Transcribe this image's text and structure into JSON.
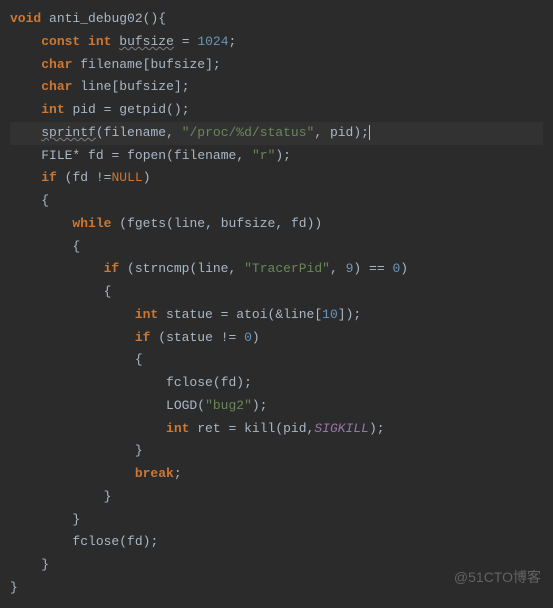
{
  "code": {
    "fn_decl": {
      "kw_void": "void",
      "name": "anti_debug02"
    },
    "l2": {
      "kw_const": "const",
      "kw_int": "int",
      "var": "bufsize",
      "eq": "=",
      "val": "1024"
    },
    "l3": {
      "kw_char": "char",
      "var": "filename",
      "idx": "bufsize"
    },
    "l4": {
      "kw_char": "char",
      "var": "line",
      "idx": "bufsize"
    },
    "l5": {
      "kw_int": "int",
      "var": "pid",
      "eq": "=",
      "call": "getpid"
    },
    "l6": {
      "call": "sprintf",
      "a1": "filename",
      "str": "\"/proc/%d/status\"",
      "a3": "pid"
    },
    "l7": {
      "type": "FILE*",
      "var": "fd",
      "eq": "=",
      "call": "fopen",
      "a1": "filename",
      "str": "\"r\""
    },
    "l8": {
      "kw_if": "if",
      "var": "fd",
      "op": "!=",
      "null": "NULL"
    },
    "l10": {
      "kw_while": "while",
      "call": "fgets",
      "a1": "line",
      "a2": "bufsize",
      "a3": "fd"
    },
    "l12": {
      "kw_if": "if",
      "call": "strncmp",
      "a1": "line",
      "str": "\"TracerPid\"",
      "n9": "9",
      "eqop": "==",
      "n0": "0"
    },
    "l14": {
      "kw_int": "int",
      "var": "statue",
      "eq": "=",
      "call": "atoi",
      "arg": "line",
      "idx": "10"
    },
    "l15": {
      "kw_if": "if",
      "var": "statue",
      "op": "!=",
      "n0": "0"
    },
    "l17": {
      "call": "fclose",
      "arg": "fd"
    },
    "l18": {
      "call": "LOGD",
      "str": "\"bug2\""
    },
    "l19": {
      "kw_int": "int",
      "var": "ret",
      "eq": "=",
      "call": "kill",
      "a1": "pid",
      "a2": "SIGKILL"
    },
    "l21": {
      "kw_break": "break"
    },
    "l24": {
      "call": "fclose",
      "arg": "fd"
    }
  },
  "watermark": "@51CTO博客"
}
